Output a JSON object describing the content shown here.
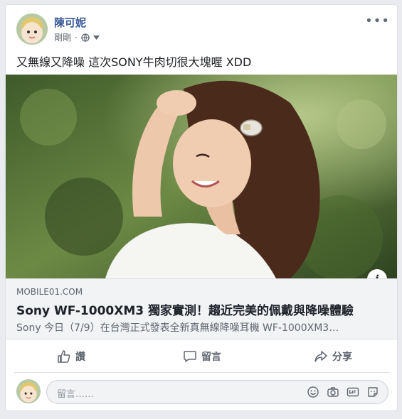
{
  "post": {
    "author": "陳可妮",
    "timestamp": "剛剛",
    "privacy_icon": "globe-icon",
    "text": "又無線又降噪 這次SONY牛肉切很大塊喔 XDD",
    "more_label": "•••"
  },
  "link": {
    "domain": "MOBILE01.COM",
    "title": "Sony WF-1000XM3 獨家實測！趨近完美的佩戴與降噪體驗",
    "description": "Sony 今日（7/9）在台灣正式發表全新真無線降噪耳機 WF-1000XM3…",
    "info_label": "i"
  },
  "actions": {
    "like": "讚",
    "comment": "留言",
    "share": "分享"
  },
  "comment": {
    "placeholder": "留言……",
    "icons": [
      "emoji-icon",
      "camera-icon",
      "gif-icon",
      "sticker-icon"
    ]
  },
  "colors": {
    "name_blue": "#385898",
    "meta_gray": "#606770",
    "background": "#e9ebee"
  }
}
